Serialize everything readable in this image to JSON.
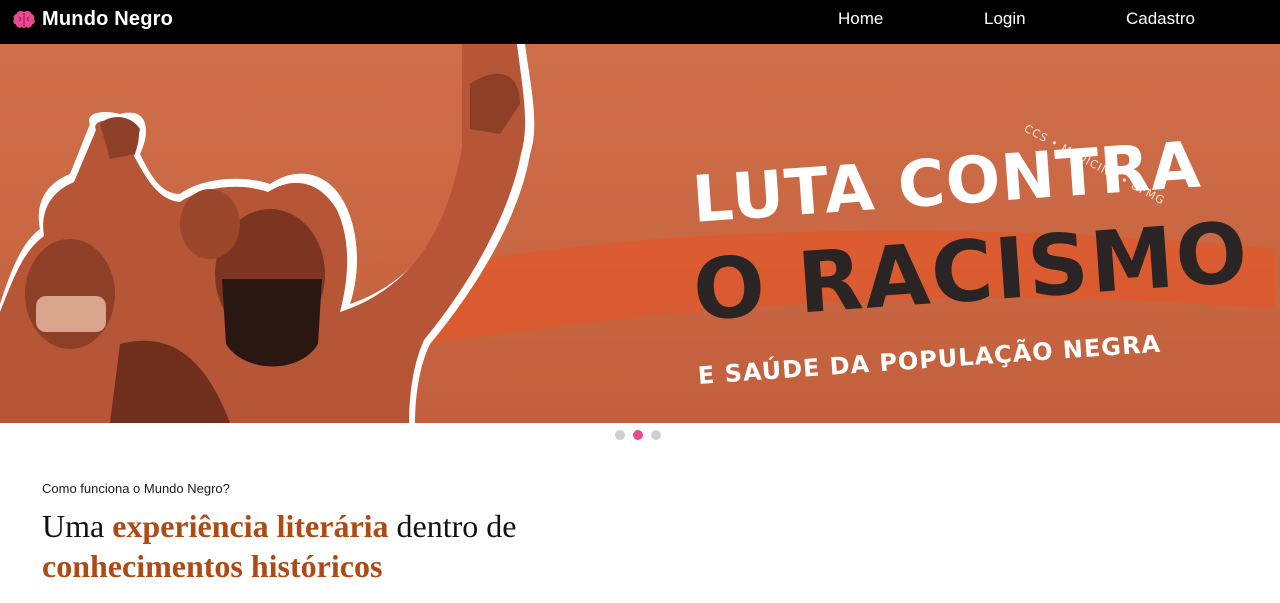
{
  "navbar": {
    "brand": {
      "title": "Mundo Negro",
      "icon": "brain-icon",
      "icon_color": "#e8498f"
    },
    "links": [
      {
        "label": "Home"
      },
      {
        "label": "Login"
      },
      {
        "label": "Cadastro"
      }
    ]
  },
  "carousel": {
    "active_index": 1,
    "slide_count": 3,
    "slide": {
      "line1": "LUTA CONTRA",
      "line2": "O RACISMO",
      "line3": "E SAÚDE DA POPULAÇÃO NEGRA",
      "arc": "CCS • MEDICINA • UFMG",
      "background_color": "#cf6e4a"
    },
    "dot_active_color": "#e8498f",
    "dot_color": "#cfcfcf"
  },
  "intro": {
    "caption": "Como funciona o Mundo Negro?",
    "heading": {
      "part1": "Uma ",
      "accent1": "experiência literária",
      "part2": " dentro de ",
      "accent2": "conhecimentos históricos"
    },
    "accent_color": "#b04a14"
  }
}
